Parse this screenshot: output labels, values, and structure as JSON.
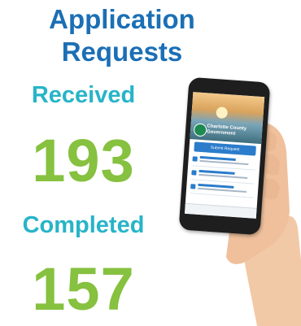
{
  "headline": {
    "line1": "Application",
    "line2": "Requests"
  },
  "received": {
    "label": "Received",
    "value": "193"
  },
  "completed": {
    "label": "Completed",
    "value": "157"
  },
  "phone_screen": {
    "org_line1": "Charlotte County",
    "org_line2": "Government",
    "button_label": "Submit Request"
  },
  "colors": {
    "headline": "#1b6fb5",
    "label": "#27b4c8",
    "number": "#86c13f"
  }
}
